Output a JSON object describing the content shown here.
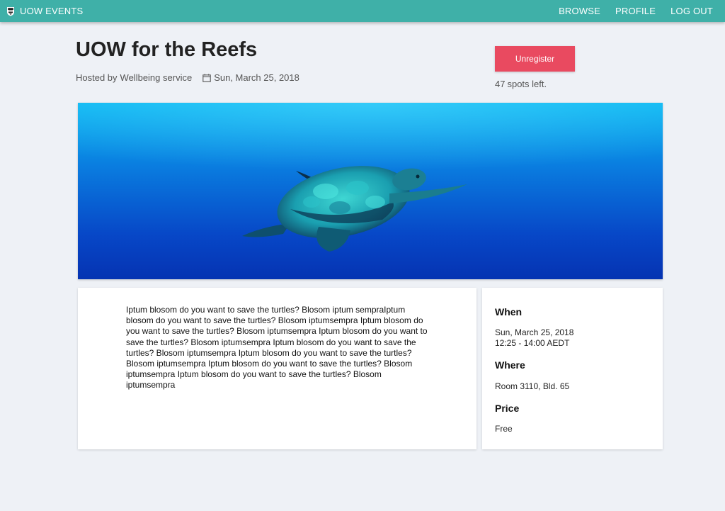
{
  "nav": {
    "brand": "UOW EVENTS",
    "links": [
      "BROWSE",
      "PROFILE",
      "LOG OUT"
    ],
    "bar_color": "#3fb0a8"
  },
  "event": {
    "title": "UOW for the Reefs",
    "host_prefix": "Hosted by",
    "host": "Wellbeing service",
    "date": "Sun, March 25, 2018",
    "calendar_icon": "calendar-icon"
  },
  "registration": {
    "button_label": "Unregister",
    "button_color": "#e94a60",
    "spots_left": "47",
    "spots_suffix": "spots left."
  },
  "hero_image": {
    "subject": "sea-turtle-underwater-photo"
  },
  "description": "Iptum blosom do you want to save the turtles? Blosom iptum sempraIptum blosom do you want to save the turtles? Blosom iptumsempra Iptum blosom do you want to save the turtles? Blosom iptumsempra Iptum blosom do you want to save the turtles? Blosom iptumsempra Iptum blosom do you want to save the turtles? Blosom iptumsempra Iptum blosom do you want to save the turtles? Blosom iptumsempra Iptum blosom do you want to save the turtles? Blosom iptumsempra Iptum blosom do you want to save the turtles? Blosom iptumsempra",
  "info": {
    "when_label": "When",
    "when_date": "Sun, March 25, 2018",
    "when_time": "12:25 - 14:00 AEDT",
    "where_label": "Where",
    "where_value": "Room 3110, Bld. 65",
    "price_label": "Price",
    "price_value": "Free"
  }
}
